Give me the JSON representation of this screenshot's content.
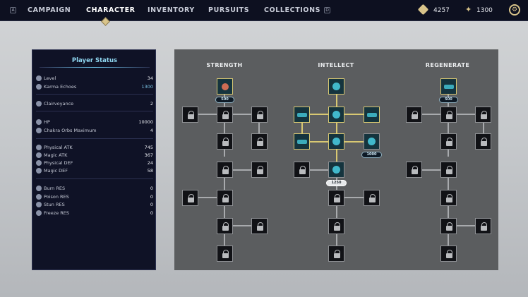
{
  "nav": {
    "left_key": "A",
    "tabs": [
      "CAMPAIGN",
      "CHARACTER",
      "INVENTORY",
      "PURSUITS",
      "COLLECTIONS"
    ],
    "active_tab": "CHARACTER",
    "right_key": "D",
    "currency": "4257",
    "ability_points": "1300",
    "icons": {
      "currency": "currency-icon",
      "ability": "ability-points-icon",
      "settings": "gear-icon"
    }
  },
  "status": {
    "title": "Player Status",
    "rows": [
      {
        "label": "Level",
        "value": "34"
      },
      {
        "label": "Karma Echoes",
        "value": "1300"
      },
      {
        "label": "Clairvoyance",
        "value": "2"
      },
      {
        "label": "HP",
        "value": "10000"
      },
      {
        "label": "Chakra Orbs Maximum",
        "value": "4"
      },
      {
        "label": "Physical ATK",
        "value": "745"
      },
      {
        "label": "Magic ATK",
        "value": "367"
      },
      {
        "label": "Physical DEF",
        "value": "24"
      },
      {
        "label": "Magic DEF",
        "value": "58"
      },
      {
        "label": "Burn RES",
        "value": "0"
      },
      {
        "label": "Poison RES",
        "value": "0"
      },
      {
        "label": "Stun RES",
        "value": "0"
      },
      {
        "label": "Freeze RES",
        "value": "0"
      }
    ]
  },
  "tree": {
    "columns": [
      "STRENGTH",
      "INTELLECT",
      "REGENERATE"
    ],
    "badges": {
      "strength_top": "500",
      "intellect_mid": "1000",
      "intellect_low": "1250",
      "regen_top": "500"
    },
    "colors": {
      "accent": "#d8c872",
      "active_fill": "#46c6da"
    }
  }
}
